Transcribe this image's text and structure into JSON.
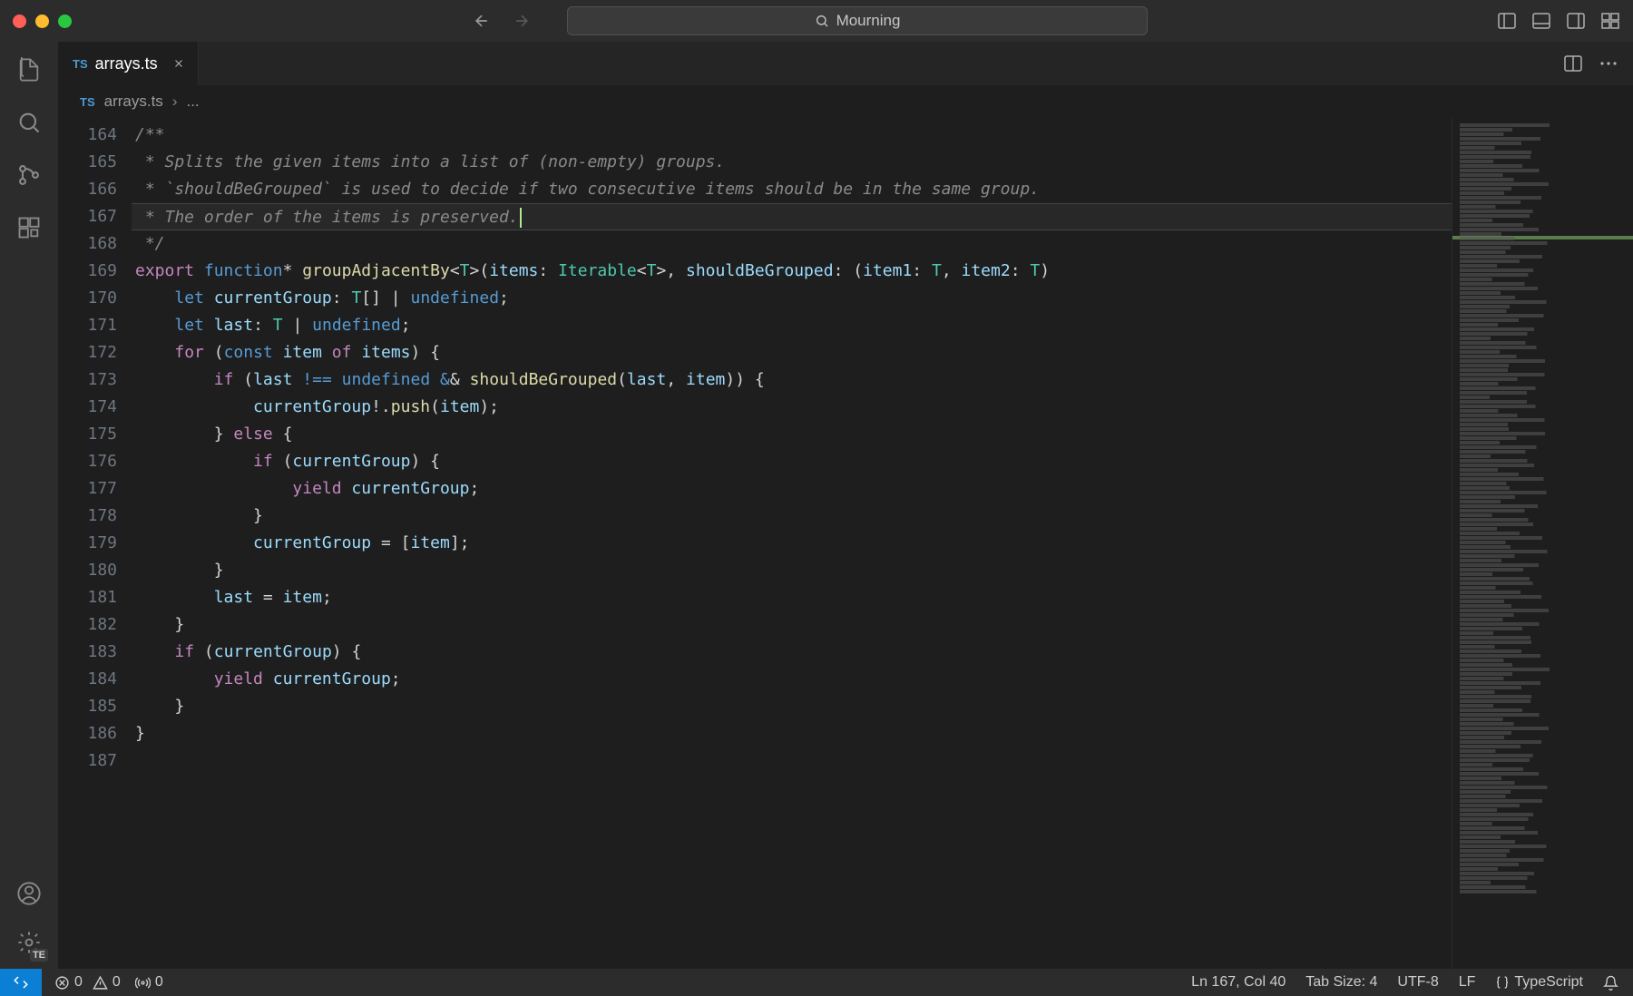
{
  "window": {
    "title": "Mourning"
  },
  "tab": {
    "lang_badge": "TS",
    "filename": "arrays.ts"
  },
  "breadcrumb": {
    "lang_badge": "TS",
    "filename": "arrays.ts",
    "rest": "..."
  },
  "gutter": {
    "start": 164,
    "end": 187
  },
  "code_lines": [
    {
      "n": 164,
      "html": "<span class='c-comment'>/**</span>"
    },
    {
      "n": 165,
      "html": "<span class='c-comment'> * Splits the given items into a list of (non-empty) groups.</span>"
    },
    {
      "n": 166,
      "html": "<span class='c-comment'> * `shouldBeGrouped` is used to decide if two consecutive items should be in the same group.</span>"
    },
    {
      "n": 167,
      "html": "<span class='c-comment'> * The order of the items is preserved.</span>",
      "cursor": true
    },
    {
      "n": 168,
      "html": "<span class='c-comment'> */</span>"
    },
    {
      "n": 169,
      "html": "<span class='c-keyword'>export</span> <span class='c-keyword2'>function</span><span class='c-punct'>*</span> <span class='c-func'>groupAdjacentBy</span><span class='c-punct'>&lt;</span><span class='c-type'>T</span><span class='c-punct'>&gt;(</span><span class='c-var'>items</span><span class='c-punct'>:</span> <span class='c-type'>Iterable</span><span class='c-punct'>&lt;</span><span class='c-type'>T</span><span class='c-punct'>&gt;,</span> <span class='c-var'>shouldBeGrouped</span><span class='c-punct'>:</span> <span class='c-punct'>(</span><span class='c-var'>item1</span><span class='c-punct'>:</span> <span class='c-type'>T</span><span class='c-punct'>,</span> <span class='c-var'>item2</span><span class='c-punct'>:</span> <span class='c-type'>T</span><span class='c-punct'>)</span>"
    },
    {
      "n": 170,
      "html": "    <span class='c-keyword2'>let</span> <span class='c-var'>currentGroup</span><span class='c-punct'>:</span> <span class='c-type'>T</span><span class='c-punct'>[] |</span> <span class='c-keyword2'>undefined</span><span class='c-punct'>;</span>"
    },
    {
      "n": 171,
      "html": "    <span class='c-keyword2'>let</span> <span class='c-var'>last</span><span class='c-punct'>:</span> <span class='c-type'>T</span> <span class='c-punct'>|</span> <span class='c-keyword2'>undefined</span><span class='c-punct'>;</span>"
    },
    {
      "n": 172,
      "html": "    <span class='c-keyword'>for</span> <span class='c-punct'>(</span><span class='c-keyword2'>const</span> <span class='c-var'>item</span> <span class='c-keyword'>of</span> <span class='c-var'>items</span><span class='c-punct'>) {</span>"
    },
    {
      "n": 173,
      "html": "        <span class='c-keyword'>if</span> <span class='c-punct'>(</span><span class='c-var'>last</span> <span class='c-keyword2'>!==</span> <span class='c-keyword2'>undefined</span> <span class='c-keyword2'>&amp;</span><span class='c-punct'>&amp;</span> <span class='c-func'>shouldBeGrouped</span><span class='c-punct'>(</span><span class='c-var'>last</span><span class='c-punct'>,</span> <span class='c-var'>item</span><span class='c-punct'>)) {</span>"
    },
    {
      "n": 174,
      "html": "            <span class='c-var'>currentGroup</span><span class='c-punct'>!.</span><span class='c-func'>push</span><span class='c-punct'>(</span><span class='c-var'>item</span><span class='c-punct'>);</span>"
    },
    {
      "n": 175,
      "html": "        <span class='c-punct'>}</span> <span class='c-keyword'>else</span> <span class='c-punct'>{</span>"
    },
    {
      "n": 176,
      "html": "            <span class='c-keyword'>if</span> <span class='c-punct'>(</span><span class='c-var'>currentGroup</span><span class='c-punct'>) {</span>"
    },
    {
      "n": 177,
      "html": "                <span class='c-keyword'>yield</span> <span class='c-var'>currentGroup</span><span class='c-punct'>;</span>"
    },
    {
      "n": 178,
      "html": "            <span class='c-punct'>}</span>"
    },
    {
      "n": 179,
      "html": "            <span class='c-var'>currentGroup</span> <span class='c-punct'>=</span> <span class='c-punct'>[</span><span class='c-var'>item</span><span class='c-punct'>];</span>"
    },
    {
      "n": 180,
      "html": "        <span class='c-punct'>}</span>"
    },
    {
      "n": 181,
      "html": "        <span class='c-var'>last</span> <span class='c-punct'>=</span> <span class='c-var'>item</span><span class='c-punct'>;</span>"
    },
    {
      "n": 182,
      "html": "    <span class='c-punct'>}</span>"
    },
    {
      "n": 183,
      "html": "    <span class='c-keyword'>if</span> <span class='c-punct'>(</span><span class='c-var'>currentGroup</span><span class='c-punct'>) {</span>"
    },
    {
      "n": 184,
      "html": "        <span class='c-keyword'>yield</span> <span class='c-var'>currentGroup</span><span class='c-punct'>;</span>"
    },
    {
      "n": 185,
      "html": "    <span class='c-punct'>}</span>"
    },
    {
      "n": 186,
      "html": "<span class='c-punct'>}</span>"
    },
    {
      "n": 187,
      "html": ""
    }
  ],
  "statusbar": {
    "errors": "0",
    "warnings": "0",
    "ports": "0",
    "position": "Ln 167, Col 40",
    "tab_size": "Tab Size: 4",
    "encoding": "UTF-8",
    "eol": "LF",
    "lang": "TypeScript"
  },
  "activity": {
    "te_badge": "TE"
  }
}
